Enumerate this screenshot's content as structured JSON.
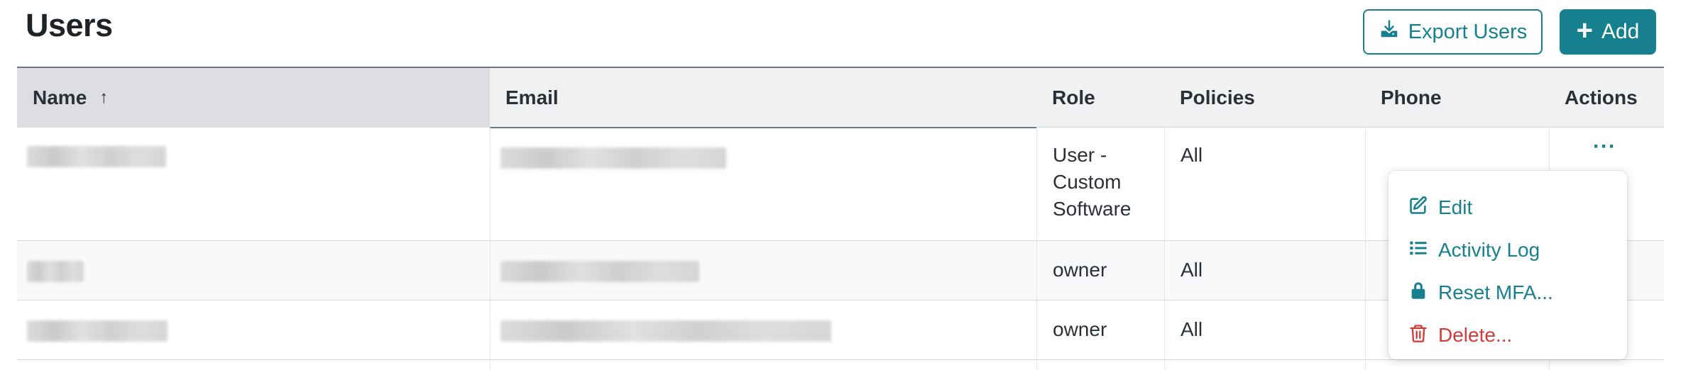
{
  "header": {
    "title": "Users",
    "export_label": "Export Users",
    "add_label": "Add"
  },
  "table": {
    "columns": {
      "name": "Name",
      "sort_indicator": "↑",
      "email": "Email",
      "role": "Role",
      "policies": "Policies",
      "phone": "Phone",
      "actions": "Actions"
    },
    "rows": [
      {
        "role_lines": [
          "User -",
          "Custom",
          "Software"
        ],
        "policies": "All",
        "actions_label": "···"
      },
      {
        "role": "owner",
        "policies": "All"
      },
      {
        "role": "owner",
        "policies": "All"
      }
    ]
  },
  "actions_menu": {
    "items": [
      {
        "label": "Edit",
        "icon": "edit-icon"
      },
      {
        "label": "Activity Log",
        "icon": "list-icon"
      },
      {
        "label": "Reset MFA...",
        "icon": "lock-icon"
      },
      {
        "label": "Delete...",
        "icon": "trash-icon"
      }
    ]
  },
  "colors": {
    "accent": "#17808f",
    "danger": "#d33b3b",
    "header_bg": "#f0f1f3",
    "sorted_header_bg": "#dddee1"
  }
}
